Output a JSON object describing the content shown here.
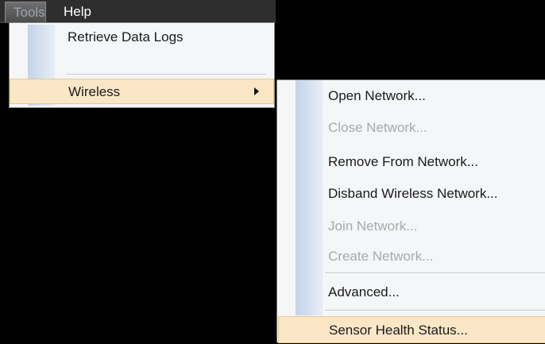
{
  "menubar": {
    "tools_label": "Tools",
    "help_label": "Help"
  },
  "tools_menu": {
    "items": [
      {
        "label": "Retrieve Data Logs"
      },
      {
        "label": "Wireless",
        "has_submenu": true,
        "highlighted": true
      }
    ]
  },
  "wireless_menu": {
    "items": [
      {
        "label": "Open Network...",
        "enabled": true
      },
      {
        "label": "Close Network...",
        "enabled": false
      },
      {
        "label": "Remove From Network...",
        "enabled": true
      },
      {
        "label": "Disband Wireless Network...",
        "enabled": true
      },
      {
        "label": "Join Network...",
        "enabled": false
      },
      {
        "label": "Create Network...",
        "enabled": false
      },
      {
        "label": "Advanced...",
        "enabled": true
      },
      {
        "label": "Sensor Health Status...",
        "enabled": true,
        "highlighted": true
      }
    ]
  },
  "colors": {
    "highlight": "#fbe6c6",
    "highlight_border": "#e9c98f",
    "menu_bg": "#f4f6f8",
    "disabled_text": "#a9a9a9"
  }
}
